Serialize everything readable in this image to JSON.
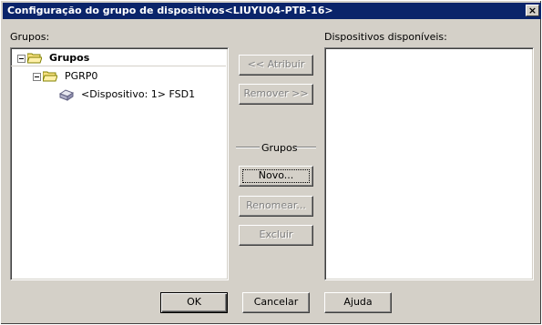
{
  "window": {
    "title": "Configuração do grupo de dispositivos<LIUYU04-PTB-16>",
    "close_label": "×"
  },
  "groups_panel": {
    "label": "Grupos:",
    "tree": [
      {
        "label": "Grupos",
        "level": 0,
        "icon": "folder-open-icon",
        "expanded": true
      },
      {
        "label": "PGRP0",
        "level": 1,
        "icon": "folder-icon",
        "expanded": true
      },
      {
        "label": "<Dispositivo: 1> FSD1",
        "level": 2,
        "icon": "disk-drive-icon"
      }
    ]
  },
  "available_panel": {
    "label": "Dispositivos disponíveis:",
    "items": []
  },
  "middle": {
    "assign_button": "<< Atribuir",
    "remove_button": "Remover >>",
    "group_section_title": "Grupos",
    "new_button": "Novo...",
    "rename_button": "Renomear...",
    "delete_button": "Excluir"
  },
  "footer": {
    "ok_button": "OK",
    "cancel_button": "Cancelar",
    "help_button": "Ajuda"
  },
  "colors": {
    "titlebar": "#0a246a",
    "face": "#d4d0c8",
    "folder": "#f8e080"
  }
}
